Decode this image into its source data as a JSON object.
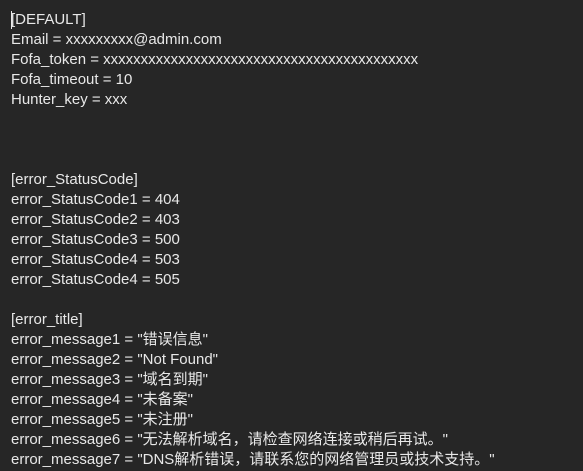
{
  "editor": {
    "lines": [
      "[DEFAULT]",
      "Email = xxxxxxxxx@admin.com",
      "Fofa_token = xxxxxxxxxxxxxxxxxxxxxxxxxxxxxxxxxxxxxxxxxx",
      "Fofa_timeout = 10",
      "Hunter_key = xxx",
      "",
      "",
      "",
      "[error_StatusCode]",
      "error_StatusCode1 = 404",
      "error_StatusCode2 = 403",
      "error_StatusCode3 = 500",
      "error_StatusCode4 = 503",
      "error_StatusCode4 = 505",
      "",
      "[error_title]",
      "error_message1 = \"错误信息\"",
      "error_message2 = \"Not Found\"",
      "error_message3 = \"域名到期\"",
      "error_message4 = \"未备案\"",
      "error_message5 = \"未注册\"",
      "error_message6 = \"无法解析域名，请检查网络连接或稍后再试。\"",
      "error_message7 = \"DNS解析错误，请联系您的网络管理员或技术支持。\""
    ]
  }
}
